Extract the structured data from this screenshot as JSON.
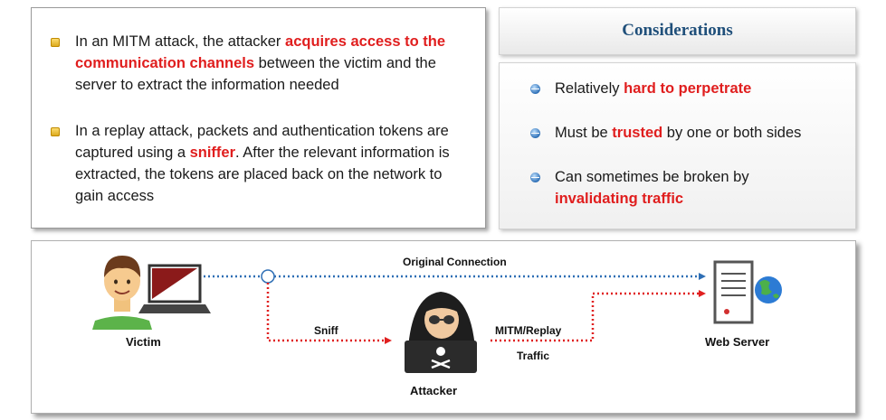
{
  "left_bullets": [
    {
      "before": "In an MITM attack, the attacker ",
      "highlight": "acquires access to the communication channels",
      "after": " between the victim and the server to extract the information needed"
    },
    {
      "before": "In a replay attack, packets and authentication tokens are captured using a ",
      "highlight": "sniffer",
      "after": ". After the relevant information is extracted, the tokens are placed back on the network to gain access"
    }
  ],
  "considerations": {
    "title": "Considerations",
    "items": [
      {
        "before": "Relatively ",
        "highlight": "hard to perpetrate",
        "after": ""
      },
      {
        "before": "Must be ",
        "highlight": "trusted",
        "after": " by one or both sides"
      },
      {
        "before": "Can sometimes be broken by ",
        "highlight": "invalidating traffic",
        "after": ""
      }
    ]
  },
  "diagram": {
    "original_connection": "Original Connection",
    "sniff": "Sniff",
    "mitm_replay": "MITM/Replay",
    "traffic": "Traffic",
    "victim": "Victim",
    "attacker": "Attacker",
    "web_server": "Web Server"
  },
  "colors": {
    "highlight": "#e01e1e",
    "blue_dotted": "#2f6fb5",
    "red_dotted": "#e02020",
    "title": "#1f4f7a"
  }
}
